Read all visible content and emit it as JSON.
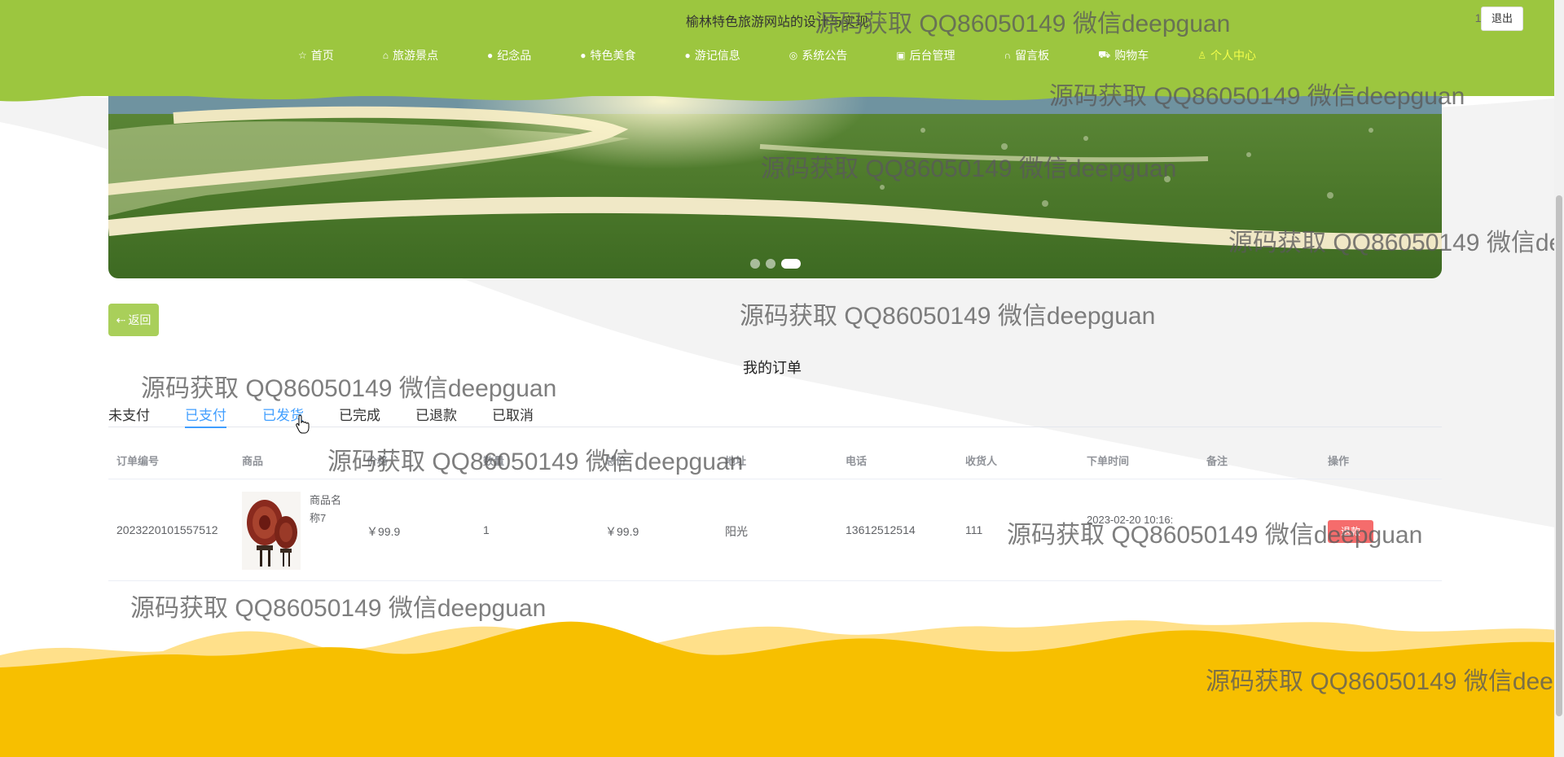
{
  "header": {
    "site_title": "榆林特色旅游网站的设计与实现",
    "user": "111",
    "logout_label": "退出",
    "nav": [
      {
        "label": "首页",
        "icon": "star-icon",
        "glyph": "☆",
        "active": false
      },
      {
        "label": "旅游景点",
        "icon": "bag-icon",
        "glyph": "⌂",
        "active": false
      },
      {
        "label": "纪念品",
        "icon": "info-icon",
        "glyph": "●",
        "active": false
      },
      {
        "label": "特色美食",
        "icon": "help-icon",
        "glyph": "●",
        "active": false
      },
      {
        "label": "游记信息",
        "icon": "question-icon",
        "glyph": "●",
        "active": false
      },
      {
        "label": "系统公告",
        "icon": "globe-icon",
        "glyph": "◎",
        "active": false
      },
      {
        "label": "后台管理",
        "icon": "building-icon",
        "glyph": "▣",
        "active": false
      },
      {
        "label": "留言板",
        "icon": "headset-icon",
        "glyph": "∩",
        "active": false
      },
      {
        "label": "购物车",
        "icon": "cart-icon",
        "glyph": "⛟",
        "active": false
      },
      {
        "label": "个人中心",
        "icon": "user-icon",
        "glyph": "♙",
        "active": true
      }
    ]
  },
  "banner": {
    "dots": 3,
    "active_dot": 3
  },
  "back_label": "返回",
  "page_heading": "我的订单",
  "tabs": [
    {
      "label": "未支付",
      "state": "normal"
    },
    {
      "label": "已支付",
      "state": "active"
    },
    {
      "label": "已发货",
      "state": "hover"
    },
    {
      "label": "已完成",
      "state": "normal"
    },
    {
      "label": "已退款",
      "state": "normal"
    },
    {
      "label": "已取消",
      "state": "normal"
    }
  ],
  "table": {
    "headers": [
      "订单编号",
      "商品",
      "价格",
      "数量",
      "总价",
      "地址",
      "电话",
      "收货人",
      "下单时间",
      "备注",
      "操作"
    ],
    "rows": [
      {
        "order_no": "2023220101557512",
        "product": "商品名称7",
        "price": "￥99.9",
        "qty": "1",
        "total": "￥99.9",
        "address": "阳光",
        "phone": "13612512514",
        "receiver": "111",
        "time": "2023-02-20 10:16:",
        "note": "",
        "op": "退款"
      }
    ]
  },
  "watermark": "源码获取 QQ86050149 微信deepguan",
  "colors": {
    "header": "#9cc63f",
    "accent": "#409eff",
    "footer": "#f7bf00",
    "danger": "#f56c6c"
  }
}
